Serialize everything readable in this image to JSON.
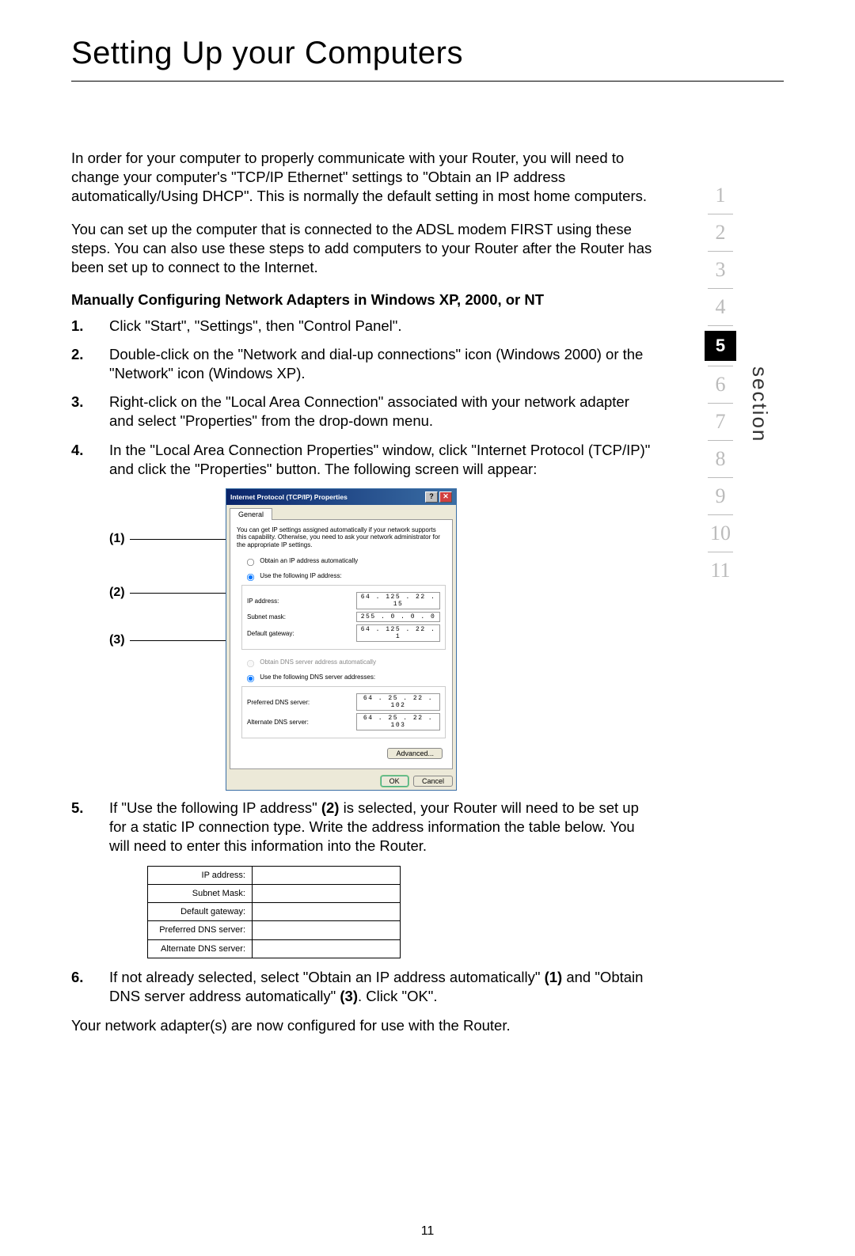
{
  "page_title": "Setting Up your Computers",
  "intro1": "In order for your computer to properly communicate with your Router, you will need to change your computer's \"TCP/IP Ethernet\" settings to \"Obtain an IP address automatically/Using DHCP\". This is normally the default setting in most home computers.",
  "intro2": "You can set up the computer that is connected to the ADSL modem FIRST using these steps. You can also use these steps to add computers to your Router after the Router has been set up to connect to the Internet.",
  "subheading": "Manually Configuring Network Adapters in Windows XP, 2000, or NT",
  "steps": {
    "s1": "Click \"Start\", \"Settings\", then \"Control Panel\".",
    "s2": "Double-click on the \"Network and dial-up connections\" icon (Windows 2000) or the \"Network\" icon (Windows XP).",
    "s3": "Right-click on the \"Local Area Connection\" associated with your network adapter and select \"Properties\" from the drop-down menu.",
    "s4": "In the \"Local Area Connection Properties\" window, click \"Internet Protocol (TCP/IP)\" and click the \"Properties\" button. The following screen will appear:",
    "s5_a": "If \"Use the following IP address\" ",
    "s5_b": "(2)",
    "s5_c": " is selected, your Router will need to be set up for a static IP connection type. Write the address information the table below. You will need to enter this information into the Router.",
    "s6_a": "If not already selected, select \"Obtain an IP address automatically\" ",
    "s6_b": "(1)",
    "s6_c": " and \"Obtain DNS server address automatically\" ",
    "s6_d": "(3)",
    "s6_e": ". Click \"OK\"."
  },
  "closing": "Your network adapter(s) are now configured for use with the Router.",
  "page_number": "11",
  "section_label": "section",
  "nav": [
    "1",
    "2",
    "3",
    "4",
    "5",
    "6",
    "7",
    "8",
    "9",
    "10",
    "11"
  ],
  "nav_active": "5",
  "callouts": {
    "c1": "(1)",
    "c2": "(2)",
    "c3": "(3)"
  },
  "dialog": {
    "title": "Internet Protocol (TCP/IP) Properties",
    "tab": "General",
    "desc": "You can get IP settings assigned automatically if your network supports this capability. Otherwise, you need to ask your network administrator for the appropriate IP settings.",
    "radio_auto_ip": "Obtain an IP address automatically",
    "radio_manual_ip": "Use the following IP address:",
    "ip_label": "IP address:",
    "ip_value": "64 . 125 . 22 .  15",
    "subnet_label": "Subnet mask:",
    "subnet_value": "255 .   0 .   0 .    0",
    "gateway_label": "Default gateway:",
    "gateway_value": "64 . 125 . 22 .    1",
    "radio_auto_dns": "Obtain DNS server address automatically",
    "radio_manual_dns": "Use the following DNS server addresses:",
    "pref_dns_label": "Preferred DNS server:",
    "pref_dns_value": "64 .  25 . 22 . 102",
    "alt_dns_label": "Alternate DNS server:",
    "alt_dns_value": "64 .  25 . 22 . 103",
    "advanced_btn": "Advanced...",
    "ok_btn": "OK",
    "cancel_btn": "Cancel"
  },
  "info_table": {
    "r1": "IP address:",
    "r2": "Subnet Mask:",
    "r3": "Default gateway:",
    "r4": "Preferred DNS server:",
    "r5": "Alternate DNS server:"
  }
}
